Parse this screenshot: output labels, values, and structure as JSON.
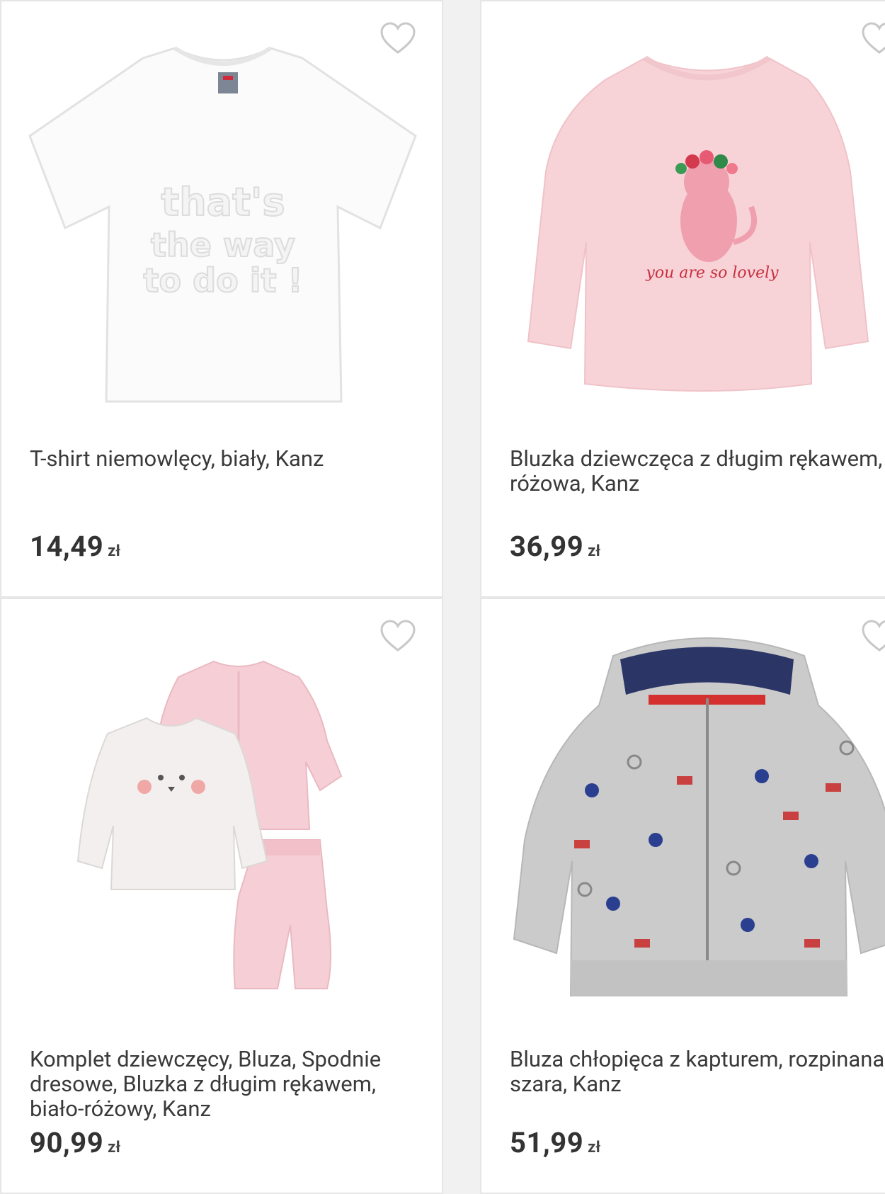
{
  "products": [
    {
      "title": "T-shirt niemowlęcy, biały, Kanz",
      "price": "14,49",
      "currency": "zł",
      "image_print_text": "that's the way to do it !"
    },
    {
      "title": "Bluzka dziewczęca z długim rękawem, różowa, Kanz",
      "price": "36,99",
      "currency": "zł",
      "image_print_text": "you are so lovely"
    },
    {
      "title": "Komplet dziewczęcy, Bluza, Spodnie dresowe, Bluzka z długim rękawem, biało-różowy, Kanz",
      "price": "90,99",
      "currency": "zł"
    },
    {
      "title": "Bluza chłopięca z kapturem, rozpinana, szara, Kanz",
      "price": "51,99",
      "currency": "zł"
    }
  ],
  "icons": {
    "favorite": "heart-outline-icon"
  },
  "colors": {
    "background": "#f1f1f1",
    "card": "#ffffff",
    "text": "#3a3a3a",
    "price": "#333333",
    "heart_stroke": "#c8c8c8",
    "pink_garment": "#f6cfd4",
    "grey_hoodie": "#c9c9c9"
  }
}
